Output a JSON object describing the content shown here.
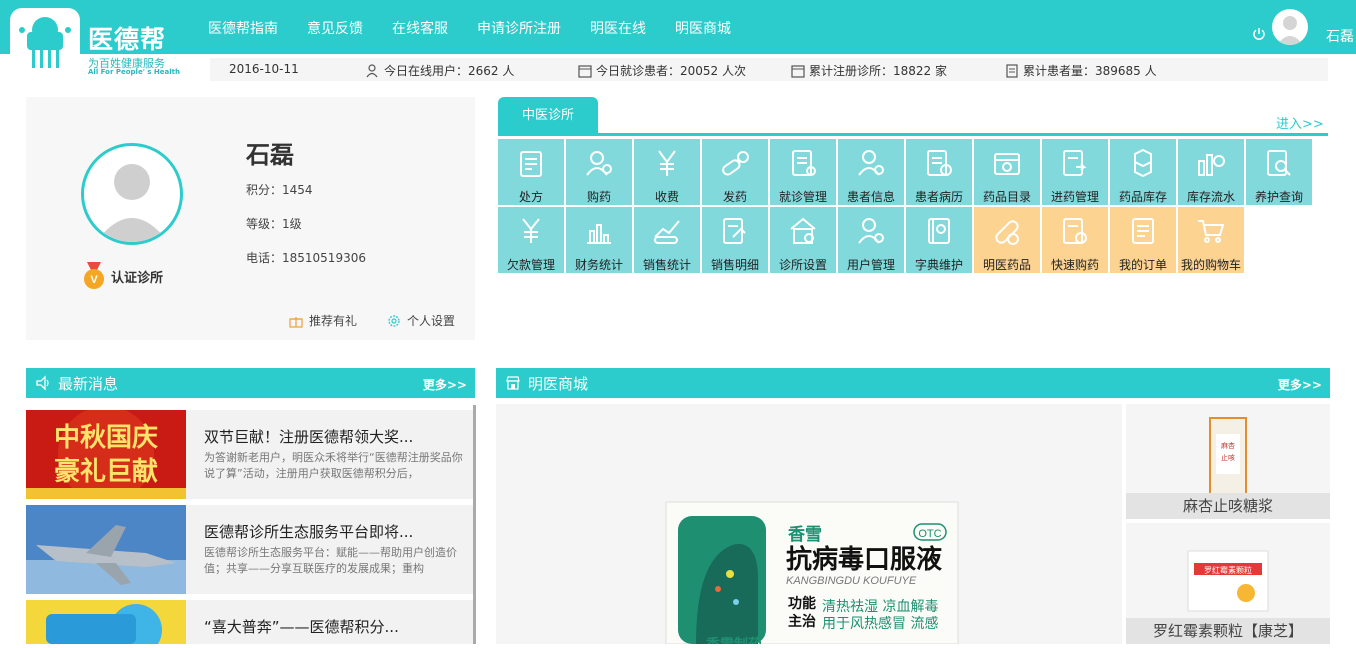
{
  "header": {
    "logo_text": "医德帮",
    "logo_sub": "为百姓健康服务",
    "logo_en": "All For People' s Health",
    "nav": [
      "医德帮指南",
      "意见反馈",
      "在线客服",
      "申请诊所注册",
      "明医在线",
      "明医商城"
    ],
    "user_name": "石磊"
  },
  "stats": {
    "date": "2016-10-11",
    "online": "今日在线用户：2662 人",
    "patients_today": "今日就诊患者：20052 人次",
    "clinics": "累计注册诊所：18822 家",
    "patients_total": "累计患者量：389685 人"
  },
  "profile": {
    "name": "石磊",
    "points": "积分：1454",
    "level": "等级：1级",
    "phone": "电话：18510519306",
    "certified": "认证诊所",
    "recommend": "推荐有礼",
    "settings": "个人设置"
  },
  "clinic": {
    "tab": "中医诊所",
    "enter": "进入>>",
    "tiles": [
      {
        "label": "处方",
        "icon": "prescription-icon",
        "orange": false
      },
      {
        "label": "购药",
        "icon": "buy-medicine-icon",
        "orange": false
      },
      {
        "label": "收费",
        "icon": "yen-icon",
        "orange": false
      },
      {
        "label": "发药",
        "icon": "pill-icon",
        "orange": false
      },
      {
        "label": "就诊管理",
        "icon": "visit-manage-icon",
        "orange": false
      },
      {
        "label": "患者信息",
        "icon": "patient-info-icon",
        "orange": false
      },
      {
        "label": "患者病历",
        "icon": "medical-record-icon",
        "orange": false
      },
      {
        "label": "药品目录",
        "icon": "drug-catalog-icon",
        "orange": false
      },
      {
        "label": "进药管理",
        "icon": "purchase-manage-icon",
        "orange": false
      },
      {
        "label": "药品库存",
        "icon": "inventory-icon",
        "orange": false
      },
      {
        "label": "库存流水",
        "icon": "stock-flow-icon",
        "orange": false
      },
      {
        "label": "养护查询",
        "icon": "maintenance-search-icon",
        "orange": false
      },
      {
        "label": "欠款管理",
        "icon": "debt-icon",
        "orange": false
      },
      {
        "label": "财务统计",
        "icon": "finance-chart-icon",
        "orange": false
      },
      {
        "label": "销售统计",
        "icon": "sales-stats-icon",
        "orange": false
      },
      {
        "label": "销售明细",
        "icon": "sales-detail-icon",
        "orange": false
      },
      {
        "label": "诊所设置",
        "icon": "clinic-settings-icon",
        "orange": false
      },
      {
        "label": "用户管理",
        "icon": "user-manage-icon",
        "orange": false
      },
      {
        "label": "字典维护",
        "icon": "dictionary-icon",
        "orange": false
      },
      {
        "label": "明医药品",
        "icon": "capsule-icon",
        "orange": true
      },
      {
        "label": "快速购药",
        "icon": "quick-buy-icon",
        "orange": true
      },
      {
        "label": "我的订单",
        "icon": "order-icon",
        "orange": true
      },
      {
        "label": "我的购物车",
        "icon": "cart-icon",
        "orange": true
      }
    ]
  },
  "news": {
    "title": "最新消息",
    "more": "更多>>",
    "items": [
      {
        "title": "双节巨献！注册医德帮领大奖...",
        "desc": "为答谢新老用户，明医众禾将举行“医德帮注册奖品你说了算”活动，注册用户获取医德帮积分后，",
        "img_text": "中秋国庆 豪礼巨献"
      },
      {
        "title": "医德帮诊所生态服务平台即将...",
        "desc": "医德帮诊所生态服务平台：赋能——帮助用户创造价值；共享——分享互联医疗的发展成果；重构",
        "img_text": ""
      },
      {
        "title": "“喜大普奔”——医德帮积分...",
        "desc": "",
        "img_text": ""
      }
    ]
  },
  "mall": {
    "title": "明医商城",
    "more": "更多>>",
    "main_product": {
      "brand": "香雪",
      "name": "抗病毒口服液",
      "pinyin": "KANGBINGDU KOUFUYE",
      "badge": "OTC",
      "func_label": "功能主治",
      "func_text": "清热祛湿  凉血解毒 用于风热感冒  流感",
      "maker": "香雪制药"
    },
    "side_products": [
      "麻杏止咳糖浆",
      "罗红霉素颗粒【康芝】"
    ],
    "side_box_texts": [
      "麻杏止咳糖浆",
      "罗红霉素颗粒"
    ]
  }
}
